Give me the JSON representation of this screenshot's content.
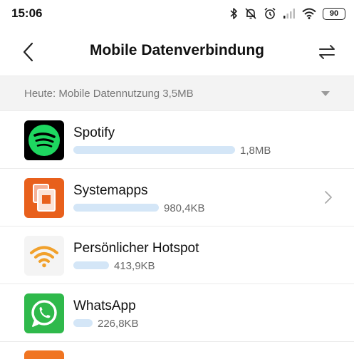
{
  "status_bar": {
    "time": "15:06",
    "battery": "90",
    "icons": [
      "bluetooth-icon",
      "mute-bell-icon",
      "alarm-icon",
      "signal-icon",
      "wifi-icon",
      "battery-icon"
    ]
  },
  "header": {
    "title": "Mobile Datenverbindung",
    "back_icon": "chevron-left-icon",
    "action_icon": "swap-arrows-icon"
  },
  "summary": {
    "text": "Heute: Mobile Datennutzung 3,5MB",
    "icon": "caret-down-icon"
  },
  "apps": [
    {
      "name": "Spotify",
      "usage": "1,8MB",
      "usage_fraction": 1.0,
      "icon": "spotify-icon",
      "chevron": false
    },
    {
      "name": "Systemapps",
      "usage": "980,4KB",
      "usage_fraction": 0.53,
      "icon": "systemapps-icon",
      "chevron": true
    },
    {
      "name": "Persönlicher Hotspot",
      "usage": "413,9KB",
      "usage_fraction": 0.22,
      "icon": "hotspot-icon",
      "chevron": false
    },
    {
      "name": "WhatsApp",
      "usage": "226,8KB",
      "usage_fraction": 0.12,
      "icon": "whatsapp-icon",
      "chevron": false
    }
  ],
  "colors": {
    "usage_bar": "#d4e6f7",
    "spotify": "#1ed760",
    "systemapps": "#e8601c",
    "hotspot": "#f1a12c",
    "whatsapp": "#2fb94b"
  }
}
